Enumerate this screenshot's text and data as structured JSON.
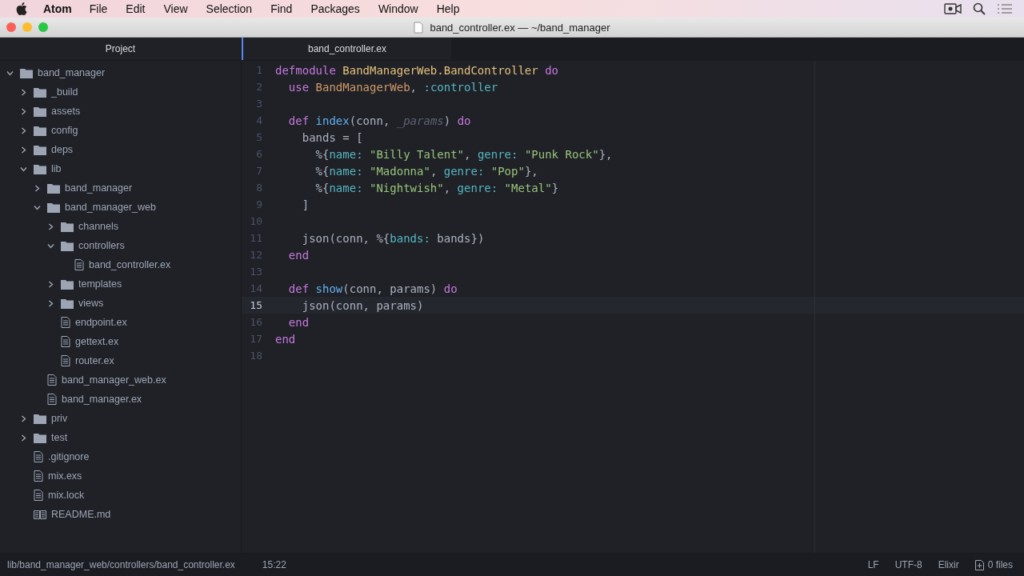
{
  "menu_bar": {
    "app": "Atom",
    "items": [
      "File",
      "Edit",
      "View",
      "Selection",
      "Find",
      "Packages",
      "Window",
      "Help"
    ]
  },
  "window": {
    "title": "band_controller.ex — ~/band_manager"
  },
  "tree_view": {
    "title": "Project",
    "root": {
      "name": "band_manager",
      "kind": "folder",
      "expanded": true,
      "children": [
        {
          "name": "_build",
          "kind": "folder",
          "expanded": false
        },
        {
          "name": "assets",
          "kind": "folder",
          "expanded": false
        },
        {
          "name": "config",
          "kind": "folder",
          "expanded": false
        },
        {
          "name": "deps",
          "kind": "folder",
          "expanded": false
        },
        {
          "name": "lib",
          "kind": "folder",
          "expanded": true,
          "children": [
            {
              "name": "band_manager",
              "kind": "folder",
              "expanded": false
            },
            {
              "name": "band_manager_web",
              "kind": "folder",
              "expanded": true,
              "children": [
                {
                  "name": "channels",
                  "kind": "folder",
                  "expanded": false
                },
                {
                  "name": "controllers",
                  "kind": "folder",
                  "expanded": true,
                  "children": [
                    {
                      "name": "band_controller.ex",
                      "kind": "file"
                    }
                  ]
                },
                {
                  "name": "templates",
                  "kind": "folder",
                  "expanded": false
                },
                {
                  "name": "views",
                  "kind": "folder",
                  "expanded": false
                },
                {
                  "name": "endpoint.ex",
                  "kind": "file"
                },
                {
                  "name": "gettext.ex",
                  "kind": "file"
                },
                {
                  "name": "router.ex",
                  "kind": "file"
                }
              ]
            },
            {
              "name": "band_manager_web.ex",
              "kind": "file"
            },
            {
              "name": "band_manager.ex",
              "kind": "file"
            }
          ]
        },
        {
          "name": "priv",
          "kind": "folder",
          "expanded": false
        },
        {
          "name": "test",
          "kind": "folder",
          "expanded": false
        },
        {
          "name": ".gitignore",
          "kind": "file"
        },
        {
          "name": "mix.exs",
          "kind": "file"
        },
        {
          "name": "mix.lock",
          "kind": "file"
        },
        {
          "name": "README.md",
          "kind": "readme"
        }
      ]
    }
  },
  "tabs": [
    {
      "label": "band_controller.ex",
      "selected": true
    }
  ],
  "editor": {
    "lines": [
      {
        "number": "1",
        "current": false,
        "tokens": [
          {
            "kind": "keyword",
            "text": "defmodule "
          },
          {
            "kind": "module",
            "text": "BandManagerWeb.BandController "
          },
          {
            "kind": "keyword",
            "text": "do"
          }
        ]
      },
      {
        "number": "2",
        "current": false,
        "tokens": [
          {
            "kind": "keyword",
            "text": "  use "
          },
          {
            "kind": "module2",
            "text": "BandManagerWeb"
          },
          {
            "kind": "plain",
            "text": ", "
          },
          {
            "kind": "atom",
            "text": ":controller"
          }
        ]
      },
      {
        "number": "3",
        "current": false
      },
      {
        "number": "4",
        "current": false,
        "tokens": [
          {
            "kind": "keyword",
            "text": "  def "
          },
          {
            "kind": "func",
            "text": "index"
          },
          {
            "kind": "plain",
            "text": "(conn, "
          },
          {
            "kind": "unused",
            "text": "_params"
          },
          {
            "kind": "plain",
            "text": ") "
          },
          {
            "kind": "keyword",
            "text": "do"
          }
        ]
      },
      {
        "number": "5",
        "current": false,
        "tokens": [
          {
            "kind": "plain",
            "text": "    bands = ["
          }
        ]
      },
      {
        "number": "6",
        "current": false,
        "tokens": [
          {
            "kind": "plain",
            "text": "      %{"
          },
          {
            "kind": "atom",
            "text": "name: "
          },
          {
            "kind": "string",
            "text": "\"Billy Talent\""
          },
          {
            "kind": "plain",
            "text": ", "
          },
          {
            "kind": "atom",
            "text": "genre: "
          },
          {
            "kind": "string",
            "text": "\"Punk Rock\""
          },
          {
            "kind": "plain",
            "text": "},"
          }
        ]
      },
      {
        "number": "7",
        "current": false,
        "tokens": [
          {
            "kind": "plain",
            "text": "      %{"
          },
          {
            "kind": "atom",
            "text": "name: "
          },
          {
            "kind": "string",
            "text": "\"Madonna\""
          },
          {
            "kind": "plain",
            "text": ", "
          },
          {
            "kind": "atom",
            "text": "genre: "
          },
          {
            "kind": "string",
            "text": "\"Pop\""
          },
          {
            "kind": "plain",
            "text": "},"
          }
        ]
      },
      {
        "number": "8",
        "current": false,
        "tokens": [
          {
            "kind": "plain",
            "text": "      %{"
          },
          {
            "kind": "atom",
            "text": "name: "
          },
          {
            "kind": "string",
            "text": "\"Nightwish\""
          },
          {
            "kind": "plain",
            "text": ", "
          },
          {
            "kind": "atom",
            "text": "genre: "
          },
          {
            "kind": "string",
            "text": "\"Metal\""
          },
          {
            "kind": "plain",
            "text": "}"
          }
        ]
      },
      {
        "number": "9",
        "current": false,
        "tokens": [
          {
            "kind": "plain",
            "text": "    ]"
          }
        ]
      },
      {
        "number": "10",
        "current": false
      },
      {
        "number": "11",
        "current": false,
        "tokens": [
          {
            "kind": "plain",
            "text": "    json(conn, %{"
          },
          {
            "kind": "atom",
            "text": "bands:"
          },
          {
            "kind": "plain",
            "text": " bands})"
          }
        ]
      },
      {
        "number": "12",
        "current": false,
        "tokens": [
          {
            "kind": "keyword",
            "text": "  end"
          }
        ]
      },
      {
        "number": "13",
        "current": false
      },
      {
        "number": "14",
        "current": false,
        "tokens": [
          {
            "kind": "keyword",
            "text": "  def "
          },
          {
            "kind": "func",
            "text": "show"
          },
          {
            "kind": "plain",
            "text": "(conn, params) "
          },
          {
            "kind": "keyword",
            "text": "do"
          }
        ]
      },
      {
        "number": "15",
        "current": true,
        "tokens": [
          {
            "kind": "plain",
            "text": "    json(conn, params)"
          }
        ]
      },
      {
        "number": "16",
        "current": false,
        "tokens": [
          {
            "kind": "keyword",
            "text": "  end"
          }
        ]
      },
      {
        "number": "17",
        "current": false,
        "tokens": [
          {
            "kind": "keyword",
            "text": "end"
          }
        ]
      },
      {
        "number": "18",
        "current": false
      }
    ]
  },
  "status_bar": {
    "path": "lib/band_manager_web/controllers/band_controller.ex",
    "cursor": "15:22",
    "line_ending": "LF",
    "encoding": "UTF-8",
    "grammar": "Elixir",
    "files": "0 files"
  }
}
